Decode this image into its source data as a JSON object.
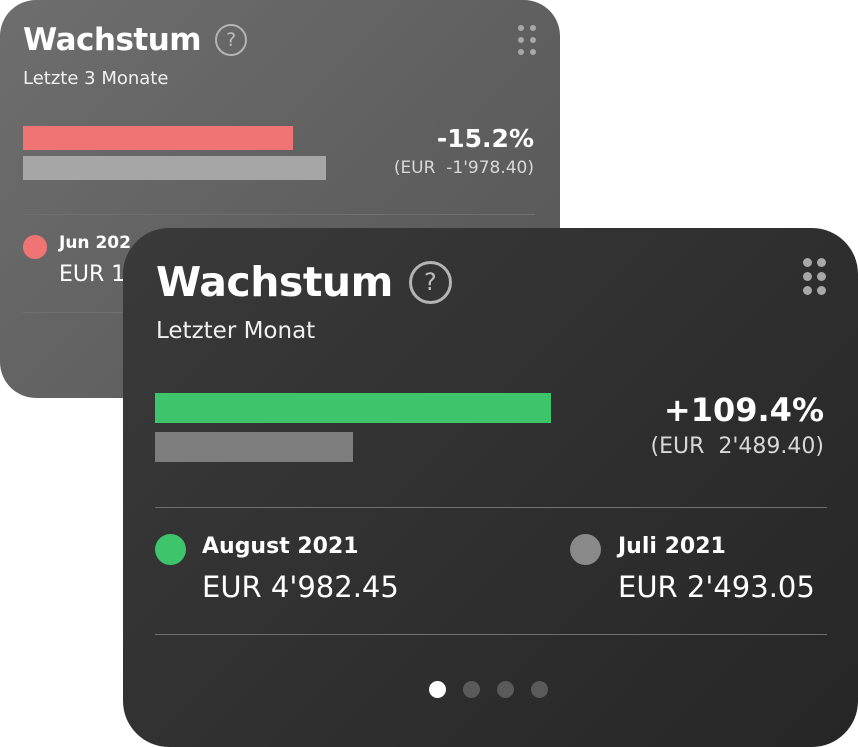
{
  "back_card": {
    "title": "Wachstum",
    "help_glyph": "?",
    "subtitle": "Letzte 3 Monate",
    "change_percent": "-15.2%",
    "change_amount": "(EUR  -1'978.40)",
    "bar_current_color": "#f07474",
    "bar_previous_color": "#a6a6a6",
    "legend_current": {
      "label": "Jun 202",
      "value": "EUR 1",
      "color": "#f07474"
    }
  },
  "front_card": {
    "title": "Wachstum",
    "help_glyph": "?",
    "subtitle": "Letzter Monat",
    "change_percent": "+109.4%",
    "change_amount": "(EUR  2'489.40)",
    "bar_current_color": "#3ec46a",
    "bar_previous_color": "#7d7d7d",
    "legend": [
      {
        "label": "August 2021",
        "value": "EUR 4'982.45",
        "color": "#3ec46a"
      },
      {
        "label": "Juli 2021",
        "value": "EUR 2'493.05",
        "color": "#8a8a8a"
      }
    ],
    "pager": {
      "pages": 4,
      "active": 1
    }
  }
}
